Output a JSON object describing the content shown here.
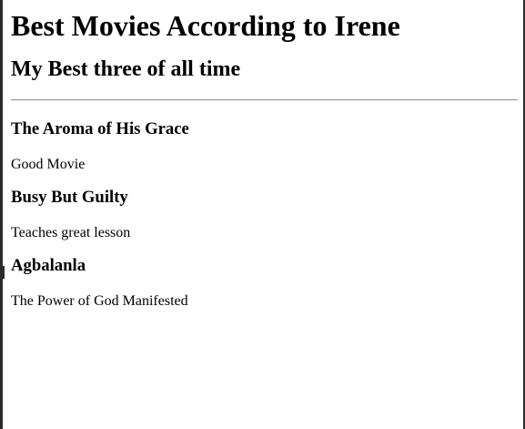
{
  "page": {
    "heading": "Best Movies According to Irene",
    "subheading": "My Best three of all time"
  },
  "movies": [
    {
      "title": "The Aroma of His Grace",
      "description": "Good Movie"
    },
    {
      "title": "Busy But Guilty",
      "description": "Teaches great lesson"
    },
    {
      "title": "Agbalanla",
      "description": "The Power of God Manifested"
    }
  ]
}
